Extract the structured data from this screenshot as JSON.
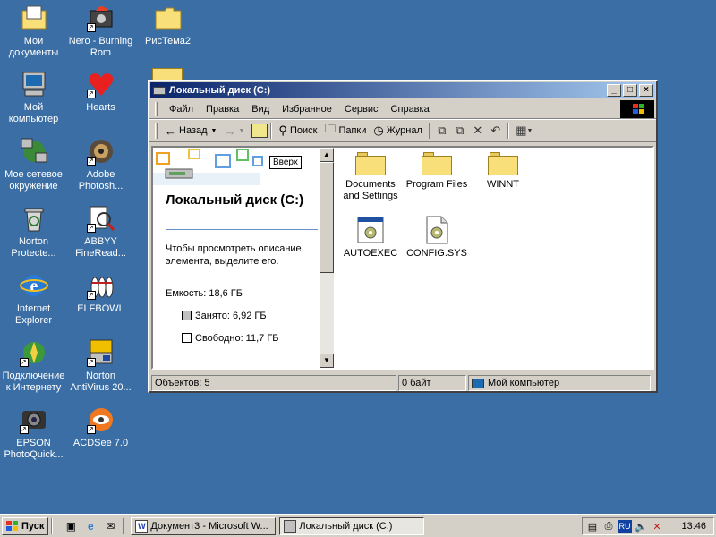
{
  "desktop": {
    "icons": [
      {
        "label": "Мои документы",
        "icon": "my-documents-icon"
      },
      {
        "label": "Nero - Burning Rom",
        "icon": "nero-icon"
      },
      {
        "label": "РисТема2",
        "icon": "folder-icon"
      },
      {
        "label": "Мой компьютер",
        "icon": "my-computer-icon"
      },
      {
        "label": "Hearts",
        "icon": "hearts-icon"
      },
      {
        "label": "Мое сетевое окружение",
        "icon": "network-icon"
      },
      {
        "label": "Adobe Photosh...",
        "icon": "photoshop-icon"
      },
      {
        "label": "Norton Protecte...",
        "icon": "recycle-bin-icon"
      },
      {
        "label": "ABBYY FineRead...",
        "icon": "finereader-icon"
      },
      {
        "label": "Internet Explorer",
        "icon": "ie-icon"
      },
      {
        "label": "ELFBOWL",
        "icon": "elfbowl-icon"
      },
      {
        "label": "Подключение к Интернету",
        "icon": "connect-internet-icon"
      },
      {
        "label": "Norton AntiVirus 20...",
        "icon": "norton-antivirus-icon"
      },
      {
        "label": "EPSON PhotoQuick...",
        "icon": "epson-icon"
      },
      {
        "label": "ACDSee 7.0",
        "icon": "acdsee-icon"
      }
    ]
  },
  "window": {
    "title": "Локальный диск (C:)",
    "controls": {
      "minimize": "_",
      "maximize": "□",
      "close": "×"
    },
    "menu": [
      "Файл",
      "Правка",
      "Вид",
      "Избранное",
      "Сервис",
      "Справка"
    ],
    "toolbar": {
      "back": "Назад",
      "search": "Поиск",
      "folders": "Папки",
      "history": "Журнал"
    },
    "left_pane": {
      "up_label": "Вверх",
      "drive_title": "Локальный диск (C:)",
      "hint": "Чтобы просмотреть описание элемента, выделите его.",
      "capacity": "Емкость: 18,6 ГБ",
      "used": "Занято: 6,92 ГБ",
      "free": "Свободно: 11,7 ГБ"
    },
    "items": [
      {
        "label": "Documents and Settings",
        "type": "folder"
      },
      {
        "label": "Program Files",
        "type": "folder"
      },
      {
        "label": "WINNT",
        "type": "folder"
      },
      {
        "label": "AUTOEXEC",
        "type": "system-file"
      },
      {
        "label": "CONFIG.SYS",
        "type": "system-file"
      }
    ],
    "status": {
      "objects": "Объектов: 5",
      "size": "0 байт",
      "location": "Мой компьютер"
    }
  },
  "taskbar": {
    "start_label": "Пуск",
    "tasks": [
      {
        "label": "Документ3 - Microsoft W...",
        "active": false
      },
      {
        "label": "Локальный диск (C:)",
        "active": true
      }
    ],
    "lang": "RU",
    "clock": "13:46"
  }
}
